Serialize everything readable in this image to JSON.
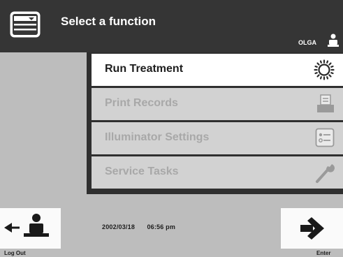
{
  "header": {
    "title": "Select a function",
    "user": "OLGA",
    "menu_icon": "list-menu-icon",
    "user_icon": "person-icon"
  },
  "menu": {
    "items": [
      {
        "label": "Run Treatment",
        "icon": "sun-burst-icon",
        "state": "active"
      },
      {
        "label": "Print Records",
        "icon": "printer-icon",
        "state": "disabled"
      },
      {
        "label": "Illuminator Settings",
        "icon": "settings-list-icon",
        "state": "disabled"
      },
      {
        "label": "Service Tasks",
        "icon": "wrench-icon",
        "state": "disabled"
      }
    ]
  },
  "footer": {
    "date": "2002/03/18",
    "time": "06:56 pm",
    "logout_label": "Log Out",
    "enter_label": "Enter"
  },
  "colors": {
    "header_bg": "#353535",
    "page_bg": "#bdbdbd",
    "active_item": "#ffffff",
    "disabled_item": "#d2d2d2",
    "disabled_text": "#a8a8a8"
  }
}
